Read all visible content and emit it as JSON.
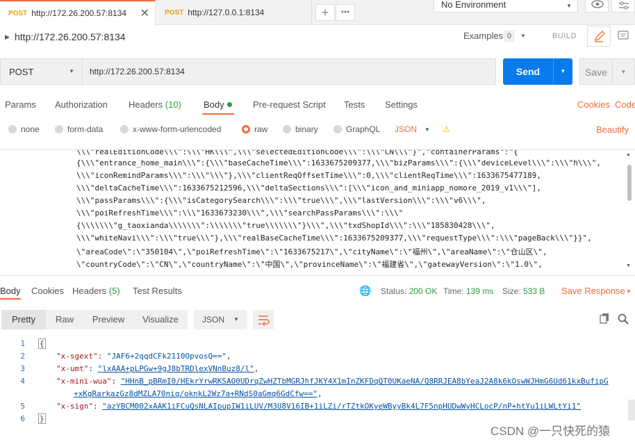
{
  "tabs": [
    {
      "method": "POST",
      "url": "http://172.26.200.57:8134",
      "active": true
    },
    {
      "method": "POST",
      "url": "http://127.0.0.1:8134",
      "active": false
    }
  ],
  "environment": {
    "label": "No Environment"
  },
  "request": {
    "title": "http://172.26.200.57:8134",
    "method": "POST",
    "url": "http://172.26.200.57:8134",
    "examples_label": "Examples",
    "examples_count": "0",
    "build_label": "BUILD"
  },
  "buttons": {
    "send": "Send",
    "save": "Save"
  },
  "request_tabs": {
    "params": "Params",
    "authorization": "Authorization",
    "headers": "Headers",
    "headers_count": "(10)",
    "body": "Body",
    "prerequest": "Pre-request Script",
    "tests": "Tests",
    "settings": "Settings",
    "cookies": "Cookies",
    "code": "Code"
  },
  "body_options": {
    "none": "none",
    "form_data": "form-data",
    "urlencoded": "x-www-form-urlencoded",
    "raw": "raw",
    "binary": "binary",
    "graphql": "GraphQL",
    "format": "JSON",
    "beautify": "Beautify",
    "selected": "raw"
  },
  "editor_lines": [
    "\\\\\\\"realEditionCode\\\\\\\":\\\\\\\"HK\\\\\\\",\\\\\\\"selectedEditionCode\\\\\\\":\\\\\\\"CN\\\\\\\"}\",\"containerParams\":\"{",
    "{\\\\\\\"entrance_home_main\\\\\\\":{\\\\\\\"baseCacheTime\\\\\\\":1633675209377,\\\\\\\"bizParams\\\\\\\":{\\\\\\\"deviceLevel\\\\\\\":\\\\\\\"h\\\\\\\",",
    "\\\\\\\"iconRemindParams\\\\\\\":\\\\\\\"\\\\\\\"},\\\\\\\"clientReqOffsetTime\\\\\\\":0,\\\\\\\"clientReqTime\\\\\\\":1633675477189,",
    "\\\\\\\"deltaCacheTime\\\\\\\":1633675212596,\\\\\\\"deltaSections\\\\\\\":[\\\\\\\"icon_and_miniapp_nomore_2019_v1\\\\\\\"],",
    "\\\\\\\"passParams\\\\\\\":{\\\\\\\"isCategorySearch\\\\\\\":\\\\\\\"true\\\\\\\",\\\\\\\"lastVersion\\\\\\\":\\\\\\\"v6\\\\\\\",",
    "\\\\\\\"poiRefreshTime\\\\\\\":\\\\\\\"1633673230\\\\\\\",\\\\\\\"searchPassParams\\\\\\\":\\\\\\\"",
    "{\\\\\\\\\\\\\\\"g_taoxianda\\\\\\\\\\\\\\\":\\\\\\\\\\\\\\\"true\\\\\\\\\\\\\\\"}\\\\\\\",\\\\\\\"txdShopId\\\\\\\":\\\\\\\"185830428\\\\\\\",",
    "\\\\\\\"whiteNavi\\\\\\\":\\\\\\\"true\\\\\\\"},\\\\\\\"realBaseCacheTime\\\\\\\":1633675209377,\\\\\\\"requestType\\\\\\\":\\\\\\\"pageBack\\\\\\\"}}\",",
    "\\\"areaCode\\\":\\\"350104\\\",\\\"poiRefreshTime\\\":\\\"1633675217\\\",\\\"cityName\\\":\\\"福州\\\",\\\"areaName\\\":\\\"仓山区\\\",",
    "\\\"countryCode\\\":\\\"CN\\\",\\\"countryName\\\":\\\"中国\\\",\\\"provinceName\\\":\\\"福建省\\\",\\\"gatewayVersion\\\":\\\"1.0\\\","
  ],
  "response_tabs": {
    "body": "Body",
    "cookies": "Cookies",
    "headers": "Headers",
    "headers_count": "(5)",
    "test_results": "Test Results"
  },
  "response_status": {
    "status_label": "Status:",
    "status_value": "200 OK",
    "time_label": "Time:",
    "time_value": "139 ms",
    "size_label": "Size:",
    "size_value": "533 B",
    "save_response": "Save Response"
  },
  "view_tabs": {
    "pretty": "Pretty",
    "raw": "Raw",
    "preview": "Preview",
    "visualize": "Visualize",
    "format": "JSON"
  },
  "response_body": {
    "line_numbers": [
      "1",
      "2",
      "3",
      "4",
      "",
      "5",
      "6"
    ],
    "open_brace": "{",
    "close_brace": "}",
    "entries": [
      {
        "key": "\"x-sgext\"",
        "value": "\"JAF6+2qqdCFk2110OpvosQ==\"",
        "sep": ","
      },
      {
        "key": "\"x-umt\"",
        "value": "\"lxAAA+pLPGw+9gJ8bTRDlexVNnBuz8/l\"",
        "sep": ","
      },
      {
        "key": "\"x-mini-wua\"",
        "value": "\"HHnB_pBRmI0/HEkrYrwRKSAO0UDrqZwHZTbMGRJhfJKY4X1mInZKFDqQT0UKaeNA/Q8RRJEA8bYeaJ2A8k6kOswWJHmG6Ud61kxBufipG",
        "value2": "+xKgRarkazGz8dMZLA70niq/oknkL2Wz7a+RNdS0aGmq6GdCfw==\"",
        "sep": ","
      },
      {
        "key": "\"x-sign\"",
        "value": "\"azYBCM002xAAK1iFCuQsNLAIpupIW1iLUV/M3U8V16IB+1iLZi/rTZtkOKyeWByyBk4L7F5npHUDwWyHCLocP/nP+htYu1iLWLtYi1\"",
        "sep": ""
      }
    ]
  },
  "watermark": "CSDN @一只快死的猿"
}
